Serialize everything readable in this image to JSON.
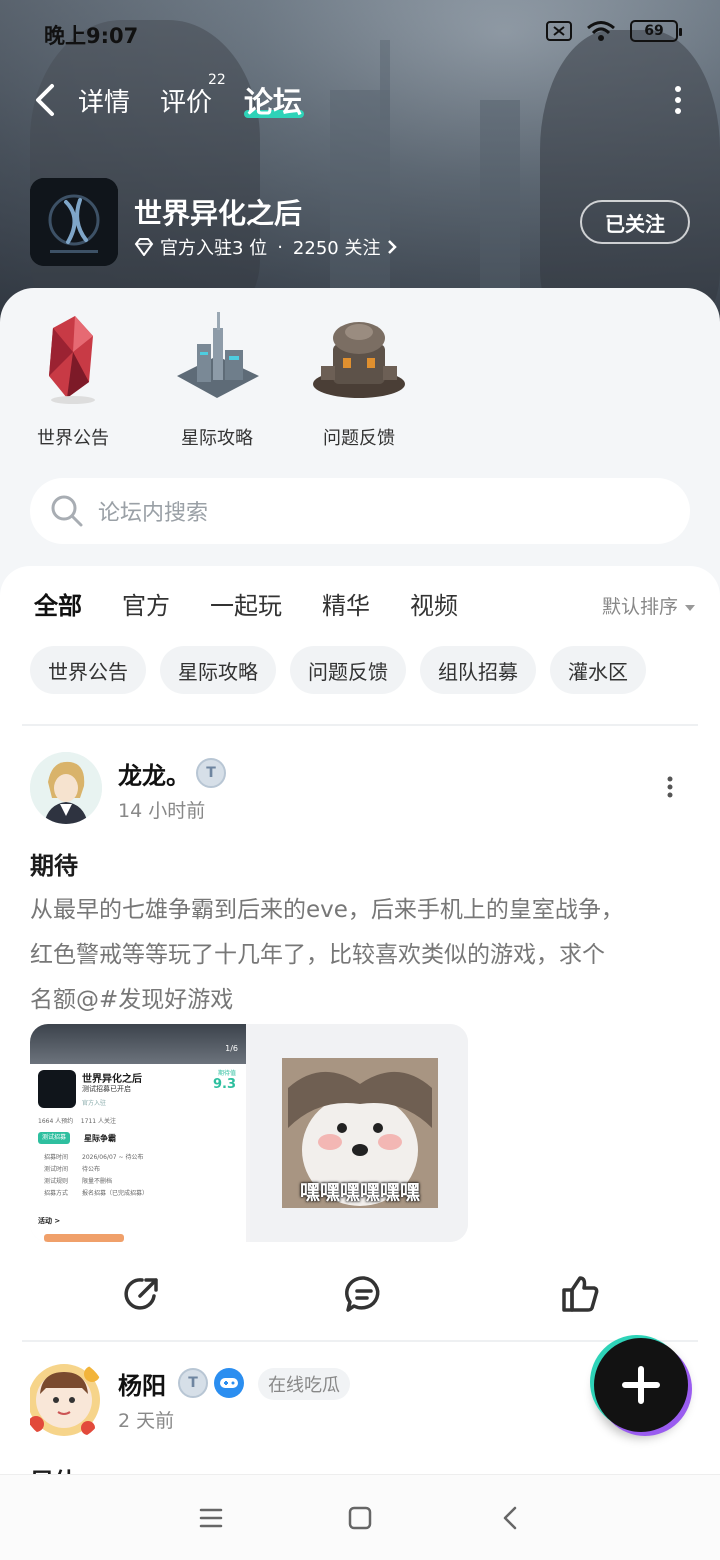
{
  "status_bar": {
    "time": "晚上9:07",
    "battery": "69"
  },
  "top_nav": {
    "tabs": [
      "详情",
      "评价",
      "论坛"
    ],
    "review_count": "22",
    "active_tab": "论坛"
  },
  "game": {
    "name": "世界异化之后",
    "official": "官方入驻3 位",
    "separator": "·",
    "followers": "2250 关注",
    "follow_button": "已关注"
  },
  "quick_links": [
    {
      "label": "世界公告",
      "icon": "red-crystal-icon"
    },
    {
      "label": "星际攻略",
      "icon": "city-building-icon"
    },
    {
      "label": "问题反馈",
      "icon": "machine-station-icon"
    }
  ],
  "search": {
    "placeholder": "论坛内搜索"
  },
  "feed_tabs": [
    "全部",
    "官方",
    "一起玩",
    "精华",
    "视频"
  ],
  "sort": "默认排序",
  "chips": [
    "世界公告",
    "星际攻略",
    "问题反馈",
    "组队招募",
    "灌水区"
  ],
  "posts": [
    {
      "user": "龙龙。",
      "time": "14 小时前",
      "title": "期待",
      "body_line1": "从最早的七雄争霸到后来的eve，后来手机上的皇室战争，",
      "body_line2": "红色警戒等等玩了十几年了，比较喜欢类似的游戏，求个",
      "body_line3": "名额@#发现好游戏",
      "thumb1": {
        "page": "1/6",
        "name": "世界异化之后",
        "sub": "测试招募已开启",
        "official": "官方入驻",
        "score_label": "期待值",
        "score": "9.3",
        "stats": "1664 人预约    1711 人关注",
        "section_tag": "测试招募",
        "section": "星际争霸",
        "rows": [
          [
            "招募时间",
            "2026/06/07 ~ 待公布"
          ],
          [
            "测试时间",
            "待公布"
          ],
          [
            "测试规则",
            "限量不删档"
          ],
          [
            "招募方式",
            "报名招募（已完成招募）"
          ]
        ],
        "activity": "活动 >"
      },
      "thumb2_caption": "嘿嘿嘿嘿嘿嘿"
    },
    {
      "user": "杨阳",
      "time": "2 天前",
      "tag": "在线吃瓜",
      "title_partial": "早体"
    }
  ],
  "colors": {
    "accent": "#2ed3b8",
    "fab": "#121212"
  }
}
